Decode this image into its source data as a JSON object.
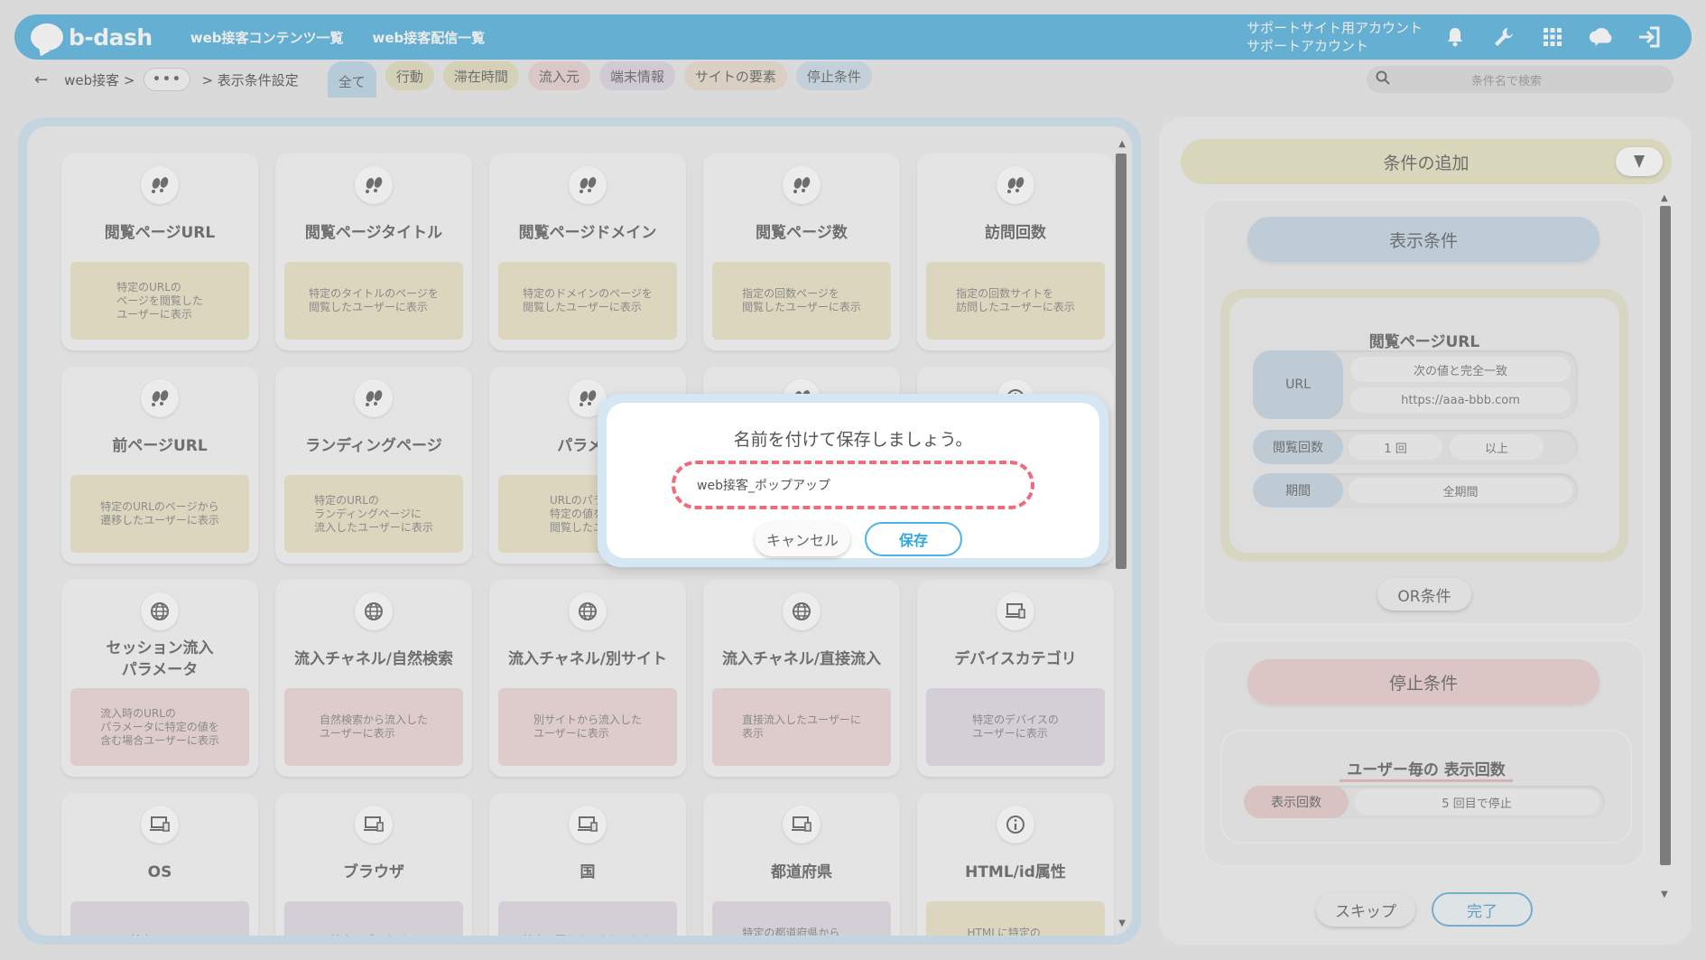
{
  "header": {
    "logo_text": "b-dash",
    "nav": [
      "web接客コンテンツ一覧",
      "web接客配信一覧"
    ],
    "account_line1": "サポートサイト用アカウント",
    "account_line2": "サポートアカウント",
    "icons": [
      "bell-icon",
      "wrench-icon",
      "grid-icon",
      "cloud-chat-icon",
      "logout-icon"
    ]
  },
  "subbar": {
    "back": "←",
    "crumb1": "web接客  >",
    "dots": "•••",
    "crumb2": ">  表示条件設定",
    "chips": [
      "全て",
      "行動",
      "滞在時間",
      "流入元",
      "端末情報",
      "サイトの要素",
      "停止条件"
    ],
    "chip_colors": [
      "#bcd7e8",
      "#e3ddc0",
      "#e3ddc0",
      "#ead2d2",
      "#ddd6e3",
      "#e8dccd",
      "#cfdde8"
    ],
    "search_placeholder": "条件名で検索"
  },
  "cards": [
    {
      "icon": "footprints-icon",
      "title": "閲覧ページURL",
      "desc": "特定のURLの\nページを閲覧した\nユーザーに表示",
      "color": "yellow"
    },
    {
      "icon": "footprints-icon",
      "title": "閲覧ページタイトル",
      "desc": "特定のタイトルのページを\n閲覧したユーザーに表示",
      "color": "yellow"
    },
    {
      "icon": "footprints-icon",
      "title": "閲覧ページドメイン",
      "desc": "特定のドメインのページを\n閲覧したユーザーに表示",
      "color": "yellow"
    },
    {
      "icon": "footprints-icon",
      "title": "閲覧ページ数",
      "desc": "指定の回数ページを\n閲覧したユーザーに表示",
      "color": "yellow"
    },
    {
      "icon": "footprints-icon",
      "title": "訪問回数",
      "desc": "指定の回数サイトを\n訪問したユーザーに表示",
      "color": "yellow"
    },
    {
      "icon": "footprints-icon",
      "title": "前ページURL",
      "desc": "特定のURLのページから\n遷移したユーザーに表示",
      "color": "yellow"
    },
    {
      "icon": "footprints-icon",
      "title": "ランディングページ",
      "desc": "特定のURLの\nランディングページに\n流入したユーザーに表示",
      "color": "yellow"
    },
    {
      "icon": "footprints-icon",
      "title": "パラメー",
      "desc": "URLのパラメー\n特定の値を含む\n閲覧したユーザ",
      "color": "yellow"
    },
    {
      "icon": "footprints-icon",
      "title": "",
      "desc": "",
      "color": "yellow"
    },
    {
      "icon": "clock-icon",
      "title": "",
      "desc": "",
      "color": "yellow"
    },
    {
      "icon": "globe-icon",
      "title": "セッション流入\nパラメータ",
      "desc": "流入時のURLの\nパラメータに特定の値を\n含む場合ユーザーに表示",
      "color": "pink"
    },
    {
      "icon": "globe-icon",
      "title": "流入チャネル/自然検索",
      "desc": "自然検索から流入した\nユーザーに表示",
      "color": "pink"
    },
    {
      "icon": "globe-icon",
      "title": "流入チャネル/別サイト",
      "desc": "別サイトから流入した\nユーザーに表示",
      "color": "pink"
    },
    {
      "icon": "globe-icon",
      "title": "流入チャネル/直接流入",
      "desc": "直接流入したユーザーに\n表示",
      "color": "pink"
    },
    {
      "icon": "laptop-icon",
      "title": "デバイスカテゴリ",
      "desc": "特定のデバイスの\nユーザーに表示",
      "color": "purple"
    },
    {
      "icon": "laptop-icon",
      "title": "OS",
      "desc": "特定のOSの",
      "color": "purple"
    },
    {
      "icon": "laptop-icon",
      "title": "ブラウザ",
      "desc": "特定のブラウザの",
      "color": "purple"
    },
    {
      "icon": "laptop-icon",
      "title": "国",
      "desc": "特定の国からアクセスした",
      "color": "purple"
    },
    {
      "icon": "laptop-icon",
      "title": "都道府県",
      "desc": "特定の都道府県から\nアクセスしたユーザーに",
      "color": "purple"
    },
    {
      "icon": "info-icon",
      "title": "HTML/id属性",
      "desc": "HTMLに特定の\nid属性を含む場合に",
      "color": "yellow"
    }
  ],
  "right": {
    "add_title": "条件の追加",
    "display_title": "表示条件",
    "cond_title": "閲覧ページURL",
    "url_label": "URL",
    "url_match": "次の値と完全一致",
    "url_value": "https://aaa-bbb.com",
    "views_label": "閲覧回数",
    "views_count": "1 回",
    "views_cmp": "以上",
    "period_label": "期間",
    "period_value": "全期間",
    "or_label": "OR条件",
    "stop_title": "停止条件",
    "stop_sub": "ユーザー毎の 表示回数",
    "stop_label": "表示回数",
    "stop_value": "5 回目で停止",
    "skip": "スキップ",
    "done": "完了"
  },
  "modal": {
    "title": "名前を付けて保存しましょう。",
    "input_value": "web接客_ポップアップ",
    "cancel": "キャンセル",
    "save": "保存"
  }
}
